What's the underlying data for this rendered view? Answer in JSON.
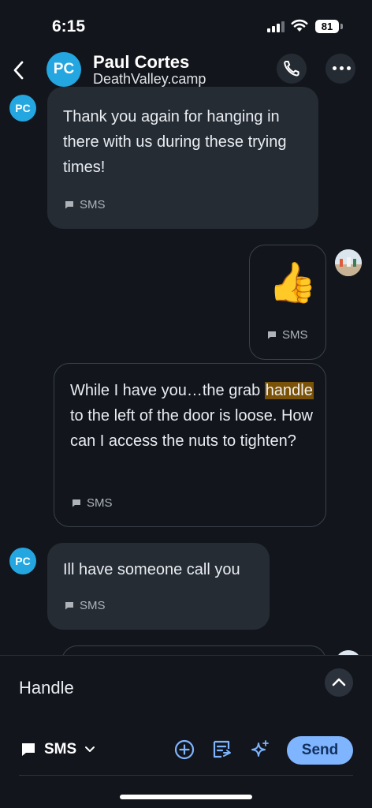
{
  "status": {
    "time": "6:15",
    "battery": "81"
  },
  "header": {
    "avatar_initials": "PC",
    "name": "Paul Cortes",
    "subtitle": "DeathValley.camp"
  },
  "messages": [
    {
      "direction": "incoming",
      "avatar_initials": "PC",
      "text": "Thank you again for hanging in there with us during these trying times!",
      "channel": "SMS"
    },
    {
      "direction": "outgoing",
      "emoji": "👍",
      "channel": "SMS"
    },
    {
      "direction": "outgoing",
      "text_before": "While I have you…the grab ",
      "highlight": "handle",
      "text_after": " to the left of the door is loose. How can I access the nuts to tighten?",
      "channel": "SMS"
    },
    {
      "direction": "incoming",
      "avatar_initials": "PC",
      "text": "Ill have someone call you",
      "channel": "SMS"
    }
  ],
  "composer": {
    "draft": "Handle",
    "channel_label": "SMS",
    "send_label": "Send"
  },
  "colors": {
    "accent": "#24a6e0",
    "send": "#7fb4ff",
    "highlight": "#7a5208"
  }
}
